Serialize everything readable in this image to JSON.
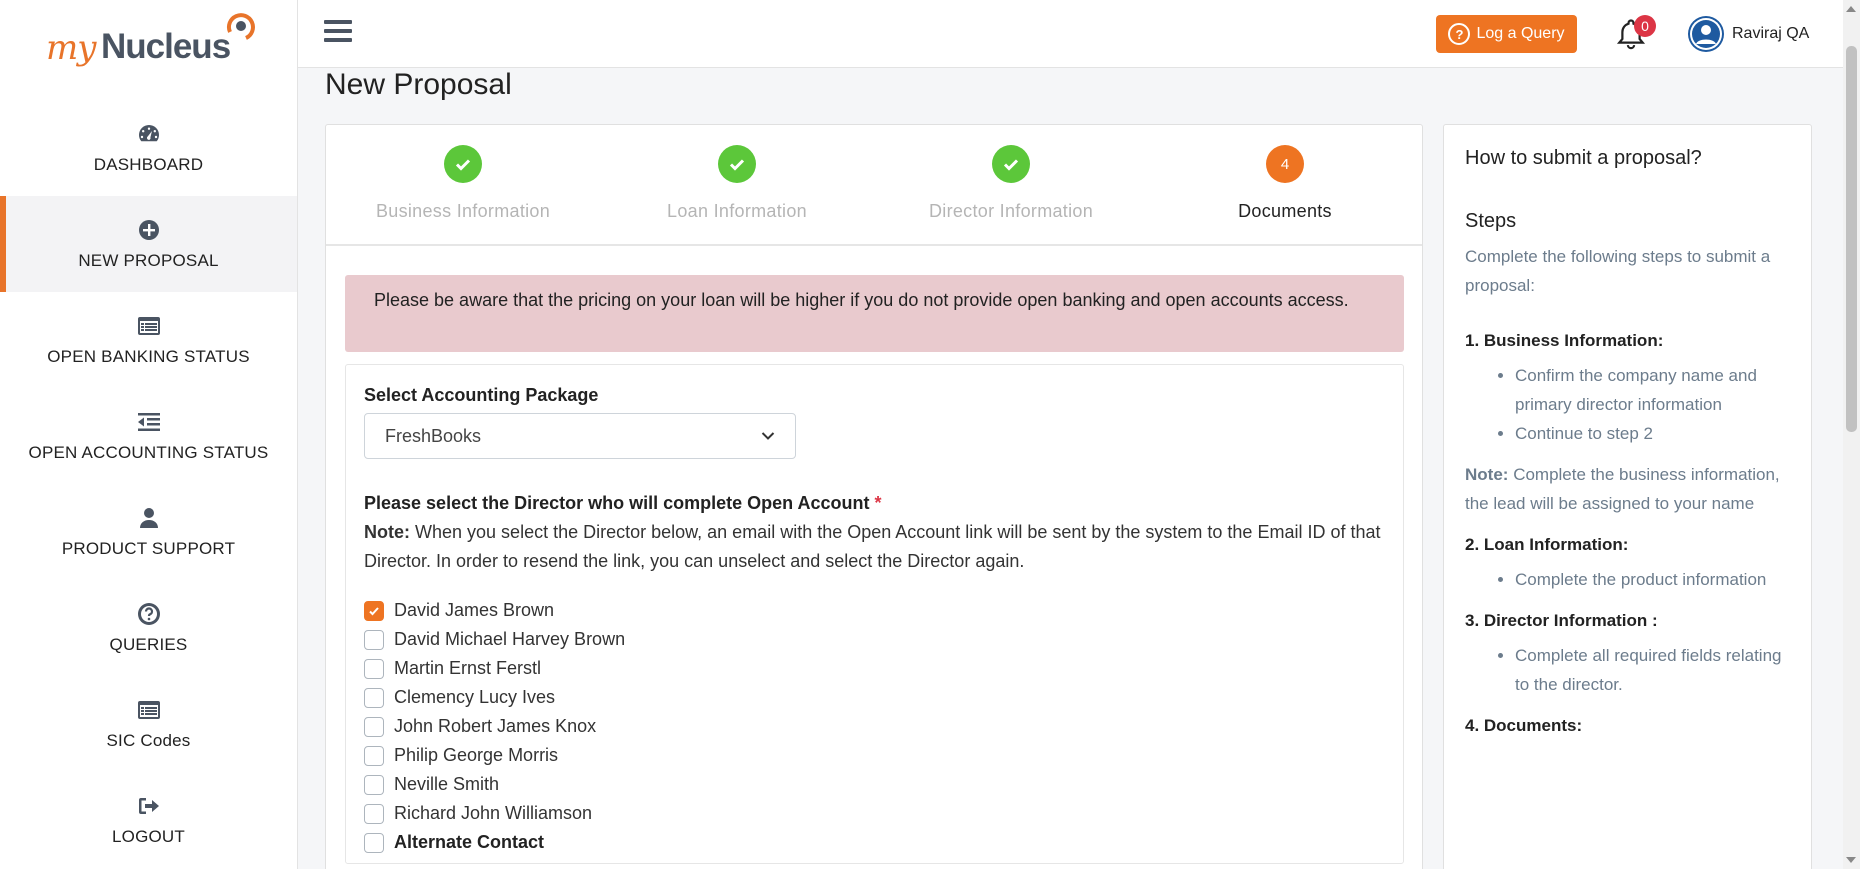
{
  "logo": {
    "my": "my",
    "nucleus": "Nucleus"
  },
  "sidebar": {
    "items": [
      {
        "label": "DASHBOARD",
        "icon": "dashboard-icon",
        "active": false
      },
      {
        "label": "NEW PROPOSAL",
        "icon": "plus-circle-icon",
        "active": true
      },
      {
        "label": "OPEN BANKING STATUS",
        "icon": "list-icon",
        "active": false
      },
      {
        "label": "OPEN ACCOUNTING STATUS",
        "icon": "indent-icon",
        "active": false
      },
      {
        "label": "PRODUCT SUPPORT",
        "icon": "user-icon",
        "active": false
      },
      {
        "label": "QUERIES",
        "icon": "question-circle-icon",
        "active": false
      },
      {
        "label": "SIC Codes",
        "icon": "list-icon",
        "active": false
      },
      {
        "label": "LOGOUT",
        "icon": "sign-out-icon",
        "active": false
      }
    ]
  },
  "topbar": {
    "query_label": "Log a Query",
    "notification_count": "0",
    "user_name": "Raviraj QA"
  },
  "page": {
    "title": "New Proposal"
  },
  "steps": [
    {
      "label": "Business Information",
      "status": "done",
      "num": ""
    },
    {
      "label": "Loan Information",
      "status": "done",
      "num": ""
    },
    {
      "label": "Director Information",
      "status": "done",
      "num": ""
    },
    {
      "label": "Documents",
      "status": "current",
      "num": "4"
    }
  ],
  "alert": "Please be aware that the pricing on your loan will be higher if you do not provide open banking and open accounts access.",
  "form": {
    "package_label": "Select Accounting Package",
    "package_value": "FreshBooks",
    "director_label": "Please select the Director who will complete Open Account",
    "required_mark": "*",
    "note_label": "Note:",
    "note_text": "When you select the Director below, an email with the Open Account link will be sent by the system to the Email ID of that Director. In order to resend the link, you can unselect and select the Director again.",
    "directors": [
      {
        "name": "David James Brown",
        "checked": true
      },
      {
        "name": "David Michael Harvey Brown",
        "checked": false
      },
      {
        "name": "Martin Ernst Ferstl",
        "checked": false
      },
      {
        "name": "Clemency Lucy Ives",
        "checked": false
      },
      {
        "name": "John Robert James Knox",
        "checked": false
      },
      {
        "name": "Philip George Morris",
        "checked": false
      },
      {
        "name": "Neville Smith",
        "checked": false
      },
      {
        "name": "Richard John Williamson",
        "checked": false
      },
      {
        "name": "Alternate Contact",
        "checked": false
      }
    ]
  },
  "help": {
    "title": "How to submit a proposal?",
    "steps_heading": "Steps",
    "intro": "Complete the following steps to submit a proposal:",
    "s1_title": "1. Business Information:",
    "s1_items": [
      "Confirm the company name and primary director information",
      "Continue to step 2"
    ],
    "s1_note_label": "Note:",
    "s1_note": "Complete the business information, the lead will be assigned to your name",
    "s2_title": "2. Loan Information:",
    "s2_items": [
      "Complete the product information"
    ],
    "s3_title": "3. Director Information :",
    "s3_items": [
      "Complete all required fields relating to the director."
    ],
    "s4_title": "4. Documents:"
  },
  "colors": {
    "accent": "#ee7422",
    "success": "#5cc73a",
    "alert_bg": "#e9cace",
    "badge": "#dc3545"
  }
}
